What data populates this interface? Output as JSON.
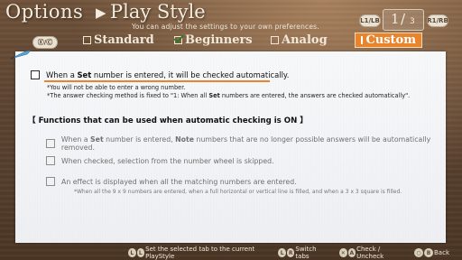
{
  "header": {
    "title": "Options",
    "separator": "▶",
    "section": "Play Style",
    "subtitle": "You can adjust the settings to your own preferences.",
    "left_button": "Ⓧ/Ⓒ",
    "lb_label": "L1/LB",
    "rb_label": "R1/RB",
    "page_current": "1",
    "page_slash": "/",
    "page_total": "3"
  },
  "tabs": [
    {
      "label": "Standard",
      "checked": false,
      "active": false
    },
    {
      "label": "Beginners",
      "checked": true,
      "active": false
    },
    {
      "label": "Analog",
      "checked": false,
      "active": false
    },
    {
      "label": "Custom",
      "checked": false,
      "active": true
    }
  ],
  "panel": {
    "main_option": {
      "pre": "When a ",
      "bold": "Set",
      "post": " number is entered, it will be checked automatically.",
      "checked": false
    },
    "note1": "*You will not be able to enter a wrong number.",
    "note2_pre": "*The answer checking method is fixed to \"1: When all ",
    "note2_bold": "Set",
    "note2_post": " numbers are entered, the answers are checked automatically\".",
    "section_heading": "【 Functions that can be used when automatic checking is ON 】",
    "sub_options": [
      {
        "pre": "When a ",
        "b1": "Set",
        "mid": " number is entered, ",
        "b2": "Note",
        "post": " numbers that are no longer possible answers will be automatically removed."
      },
      {
        "text": "When checked, selection from the number wheel is skipped."
      },
      {
        "text": "An effect is displayed when all the matching numbers are entered."
      }
    ],
    "footnote": "*When all the 9 x 9 numbers are entered, when a full horizontal or vertical line is filled, and when a 3 x 3 square is filled."
  },
  "footer": {
    "set_tab": "Set the selected tab to the current PlayStyle",
    "switch_tabs": "Switch tabs",
    "check": "Check / Uncheck",
    "back": "Back"
  },
  "colors": {
    "accent": "#e8842c",
    "panel": "#f4f5f7",
    "wood": "#5a4230"
  }
}
